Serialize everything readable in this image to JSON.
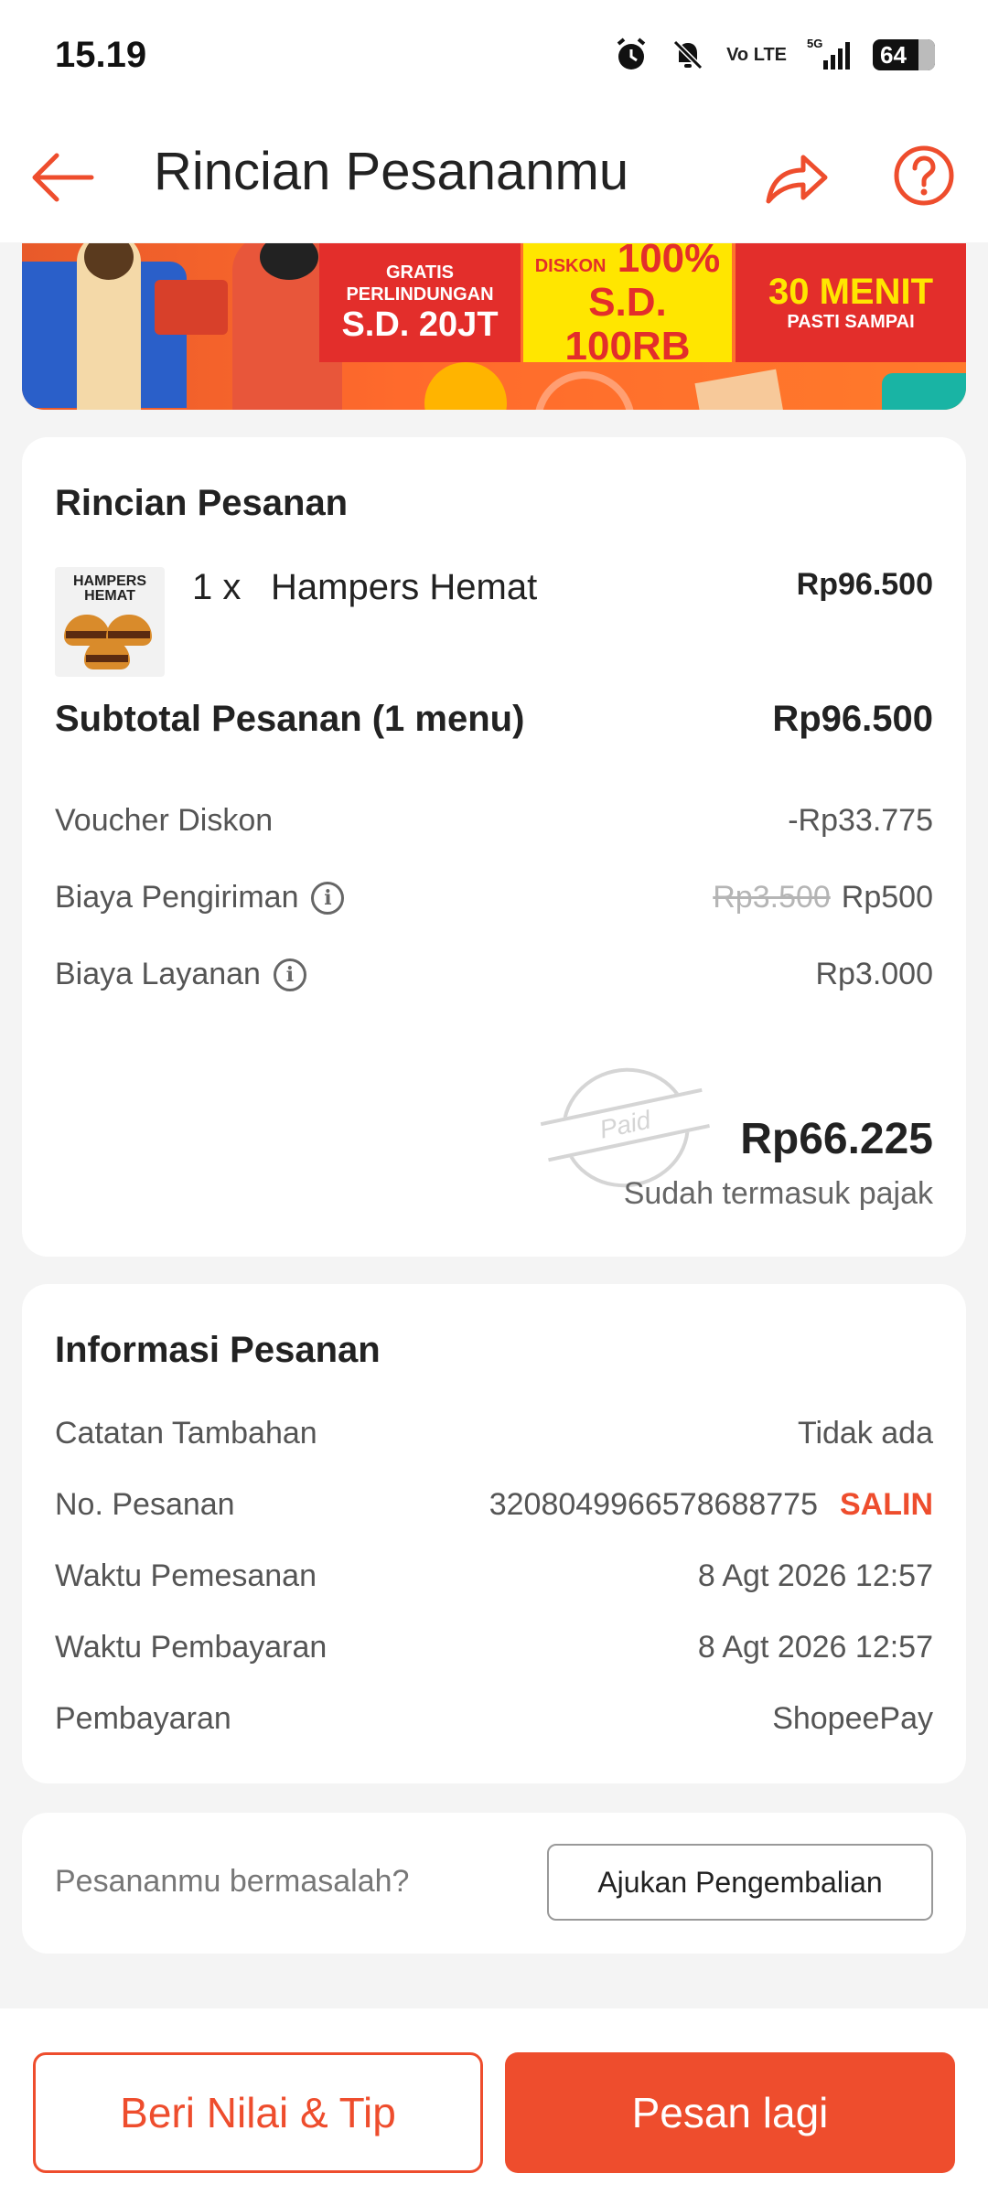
{
  "status_bar": {
    "time": "15.19",
    "network": "5G",
    "lte": "Vo LTE",
    "battery": "64"
  },
  "header": {
    "title": "Rincian Pesananmu",
    "back_icon": "arrow-left-icon",
    "share_icon": "share-icon",
    "help_icon": "help-circle-icon"
  },
  "banner": {
    "promo1_line1": "GRATIS",
    "promo1_line2": "PERLINDUNGAN",
    "promo1_big": "S.D. 20JT",
    "promo2_small": "DISKON",
    "promo2_big1": "100%",
    "promo2_big2": "S.D. 100RB",
    "promo3_big": "30 MENIT",
    "promo3_small": "PASTI SAMPAI"
  },
  "order_details": {
    "title": "Rincian Pesanan",
    "item": {
      "thumb_label": "HAMPERS HEMAT",
      "qty": "1 x",
      "name": "Hampers Hemat",
      "price": "Rp96.500"
    },
    "subtotal_label": "Subtotal Pesanan (1 menu)",
    "subtotal_value": "Rp96.500",
    "voucher_label": "Voucher Diskon",
    "voucher_value": "-Rp33.775",
    "shipping_label": "Biaya Pengiriman",
    "shipping_original": "Rp3.500",
    "shipping_value": "Rp500",
    "service_label": "Biaya Layanan",
    "service_value": "Rp3.000",
    "stamp": "Paid",
    "total": "Rp66.225",
    "total_note": "Sudah termasuk pajak"
  },
  "order_info": {
    "title": "Informasi Pesanan",
    "notes_label": "Catatan Tambahan",
    "notes_value": "Tidak ada",
    "order_no_label": "No. Pesanan",
    "order_no_value": "3208049966578688775",
    "copy_label": "SALIN",
    "order_time_label": "Waktu Pemesanan",
    "order_time_value": "8 Agt 2026 12:57",
    "payment_time_label": "Waktu Pembayaran",
    "payment_time_value": "8 Agt 2026 12:57",
    "payment_label": "Pembayaran",
    "payment_value": "ShopeePay"
  },
  "problem": {
    "text": "Pesananmu bermasalah?",
    "button": "Ajukan Pengembalian"
  },
  "actions": {
    "rate": "Beri Nilai & Tip",
    "reorder": "Pesan lagi"
  },
  "colors": {
    "accent": "#ee4d2d"
  }
}
